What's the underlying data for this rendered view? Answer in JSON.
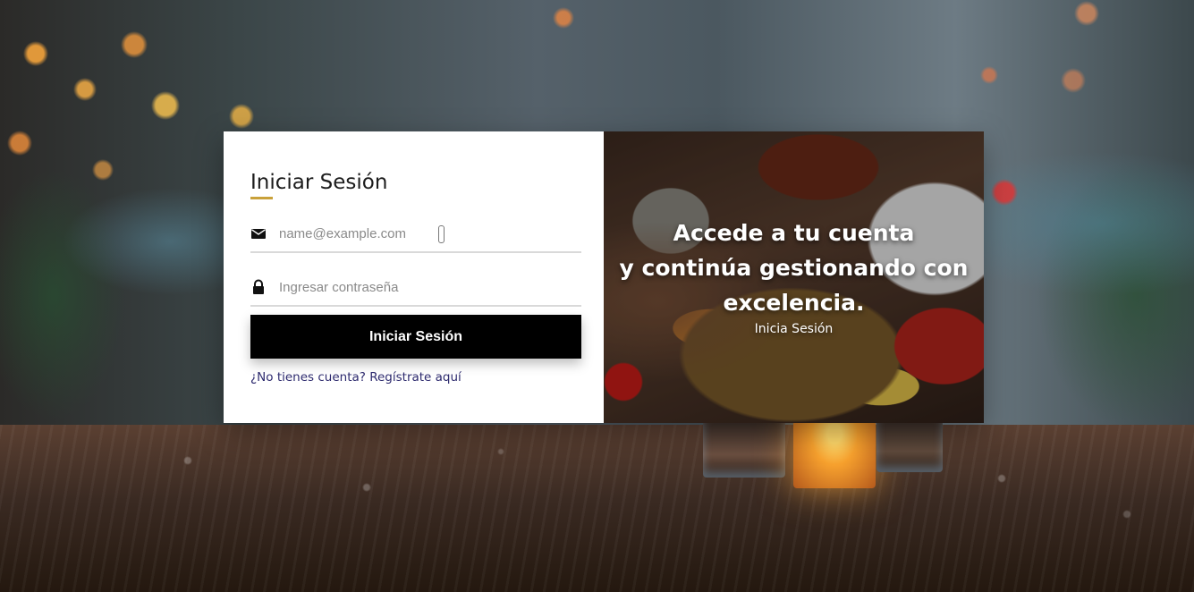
{
  "login": {
    "title": "Iniciar Sesión",
    "email": {
      "placeholder": "name@example.com",
      "icon": "envelope-icon"
    },
    "password": {
      "placeholder": "Ingresar contraseña",
      "icon": "lock-icon"
    },
    "submit_label": "Iniciar Sesión",
    "register_link": "¿No tienes cuenta? Regístrate aquí"
  },
  "hero": {
    "line1": "Accede a tu cuenta",
    "line2": "y continúa gestionando con",
    "line3": "excelencia.",
    "subtitle": "Inicia Sesión"
  },
  "colors": {
    "accent": "#c9a13a",
    "button_bg": "#000000",
    "link": "#2d2a6e"
  }
}
